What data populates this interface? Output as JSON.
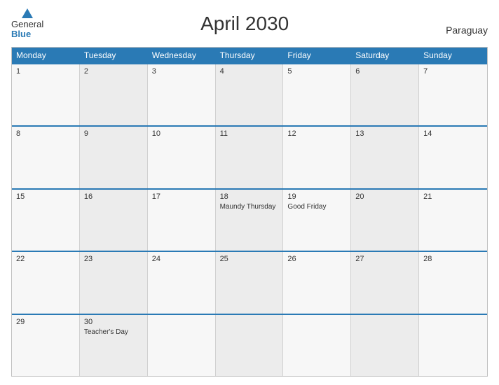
{
  "header": {
    "title": "April 2030",
    "country": "Paraguay",
    "logo": {
      "general": "General",
      "blue": "Blue"
    }
  },
  "days": [
    "Monday",
    "Tuesday",
    "Wednesday",
    "Thursday",
    "Friday",
    "Saturday",
    "Sunday"
  ],
  "weeks": [
    [
      {
        "day": "1",
        "event": ""
      },
      {
        "day": "2",
        "event": ""
      },
      {
        "day": "3",
        "event": ""
      },
      {
        "day": "4",
        "event": ""
      },
      {
        "day": "5",
        "event": ""
      },
      {
        "day": "6",
        "event": ""
      },
      {
        "day": "7",
        "event": ""
      }
    ],
    [
      {
        "day": "8",
        "event": ""
      },
      {
        "day": "9",
        "event": ""
      },
      {
        "day": "10",
        "event": ""
      },
      {
        "day": "11",
        "event": ""
      },
      {
        "day": "12",
        "event": ""
      },
      {
        "day": "13",
        "event": ""
      },
      {
        "day": "14",
        "event": ""
      }
    ],
    [
      {
        "day": "15",
        "event": ""
      },
      {
        "day": "16",
        "event": ""
      },
      {
        "day": "17",
        "event": ""
      },
      {
        "day": "18",
        "event": "Maundy Thursday"
      },
      {
        "day": "19",
        "event": "Good Friday"
      },
      {
        "day": "20",
        "event": ""
      },
      {
        "day": "21",
        "event": ""
      }
    ],
    [
      {
        "day": "22",
        "event": ""
      },
      {
        "day": "23",
        "event": ""
      },
      {
        "day": "24",
        "event": ""
      },
      {
        "day": "25",
        "event": ""
      },
      {
        "day": "26",
        "event": ""
      },
      {
        "day": "27",
        "event": ""
      },
      {
        "day": "28",
        "event": ""
      }
    ],
    [
      {
        "day": "29",
        "event": ""
      },
      {
        "day": "30",
        "event": "Teacher's Day"
      },
      {
        "day": "",
        "event": ""
      },
      {
        "day": "",
        "event": ""
      },
      {
        "day": "",
        "event": ""
      },
      {
        "day": "",
        "event": ""
      },
      {
        "day": "",
        "event": ""
      }
    ]
  ]
}
